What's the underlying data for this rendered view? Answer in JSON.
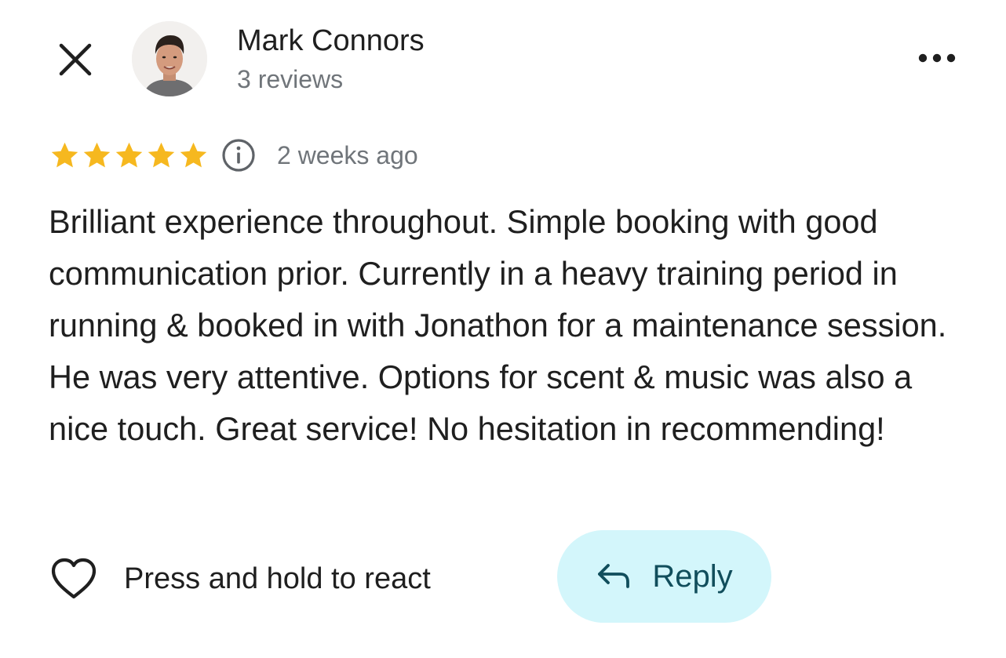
{
  "header": {
    "close_icon": "close-icon",
    "author": {
      "name": "Mark Connors",
      "reviews": "3 reviews"
    },
    "more_icon": "more-horizontal-icon"
  },
  "review": {
    "rating": 5,
    "rating_max": 5,
    "star_color": "#f6b81f",
    "info_icon": "info-icon",
    "date": "2 weeks ago",
    "text": "Brilliant experience throughout. Simple booking with good communication prior. Currently in a heavy training period in running & booked in with Jonathon for a maintenance session. He was very attentive. Options for scent & music was also a nice touch. Great service! No hesitation in recommending!"
  },
  "actions": {
    "react_icon": "heart-icon",
    "react_label": "Press and hold to react",
    "reply_icon": "reply-arrow-icon",
    "reply_label": "Reply",
    "reply_bg": "#d3f6fb",
    "reply_text_color": "#114e5c"
  }
}
